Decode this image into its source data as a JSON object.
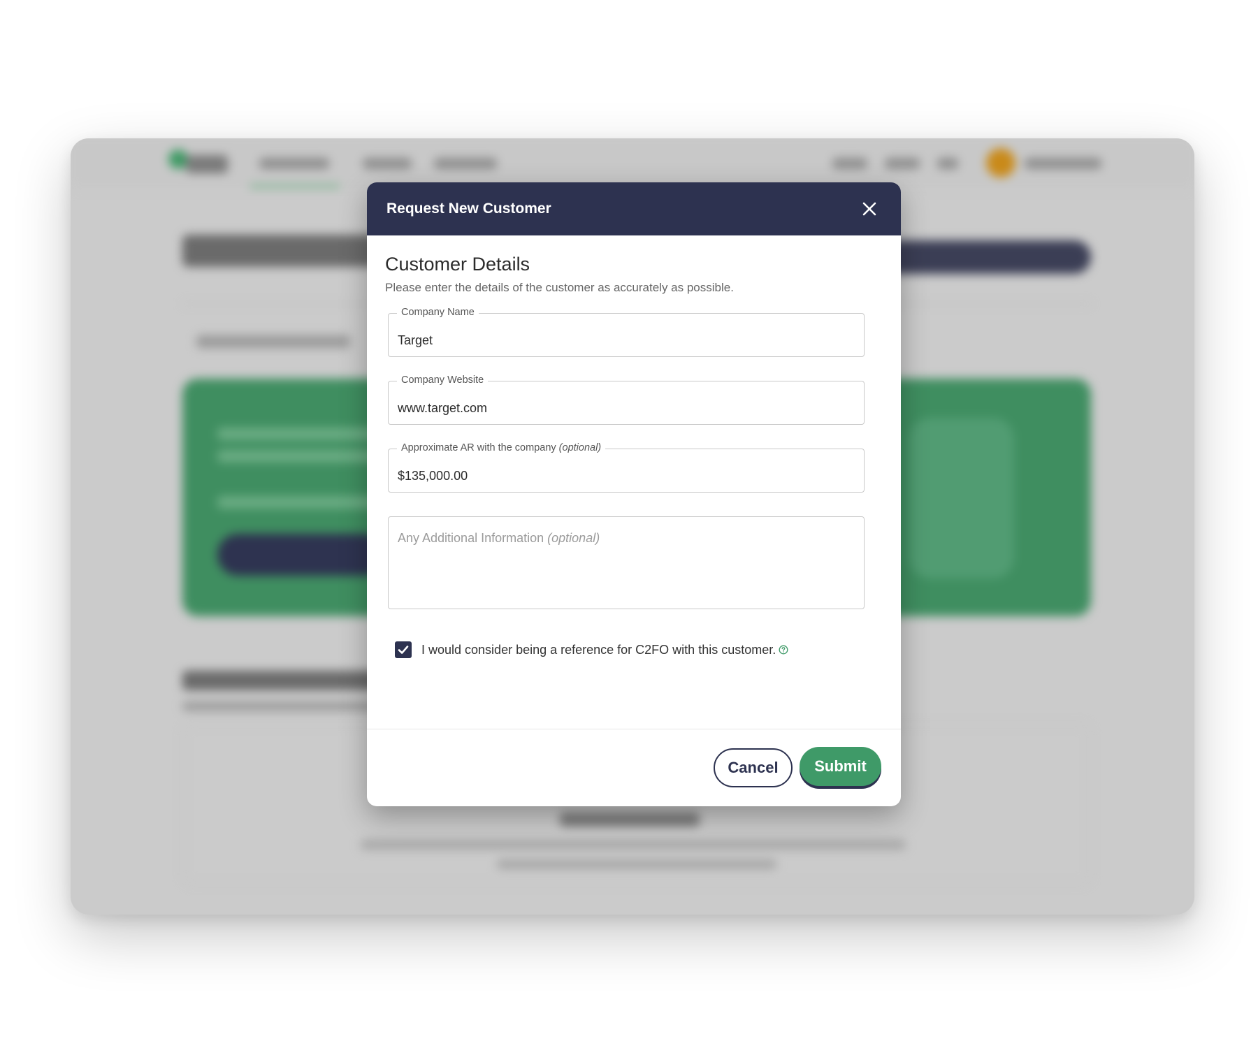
{
  "modal": {
    "title": "Request New Customer",
    "section_title": "Customer Details",
    "section_subtitle": "Please enter the details of the customer as accurately as possible.",
    "fields": [
      {
        "label": "Company Name",
        "label_optional": "",
        "value": "Target"
      },
      {
        "label": "Company Website",
        "label_optional": "",
        "value": "www.target.com"
      },
      {
        "label": "Approximate AR with the company",
        "label_optional": "(optional)",
        "value": "$135,000.00"
      }
    ],
    "additional_info": {
      "placeholder": "Any Additional Information",
      "placeholder_optional": "(optional)",
      "value": ""
    },
    "reference_checkbox": {
      "checked": true,
      "label": "I would consider being a reference for C2FO with this customer."
    },
    "cancel_label": "Cancel",
    "submit_label": "Submit"
  },
  "colors": {
    "header": "#2d3250",
    "primary_green": "#3f9a68",
    "overlay": "#cbcbcb"
  },
  "icons": {
    "close": "close-icon",
    "checkbox": "checkmark-icon",
    "help": "help-circle-icon"
  }
}
